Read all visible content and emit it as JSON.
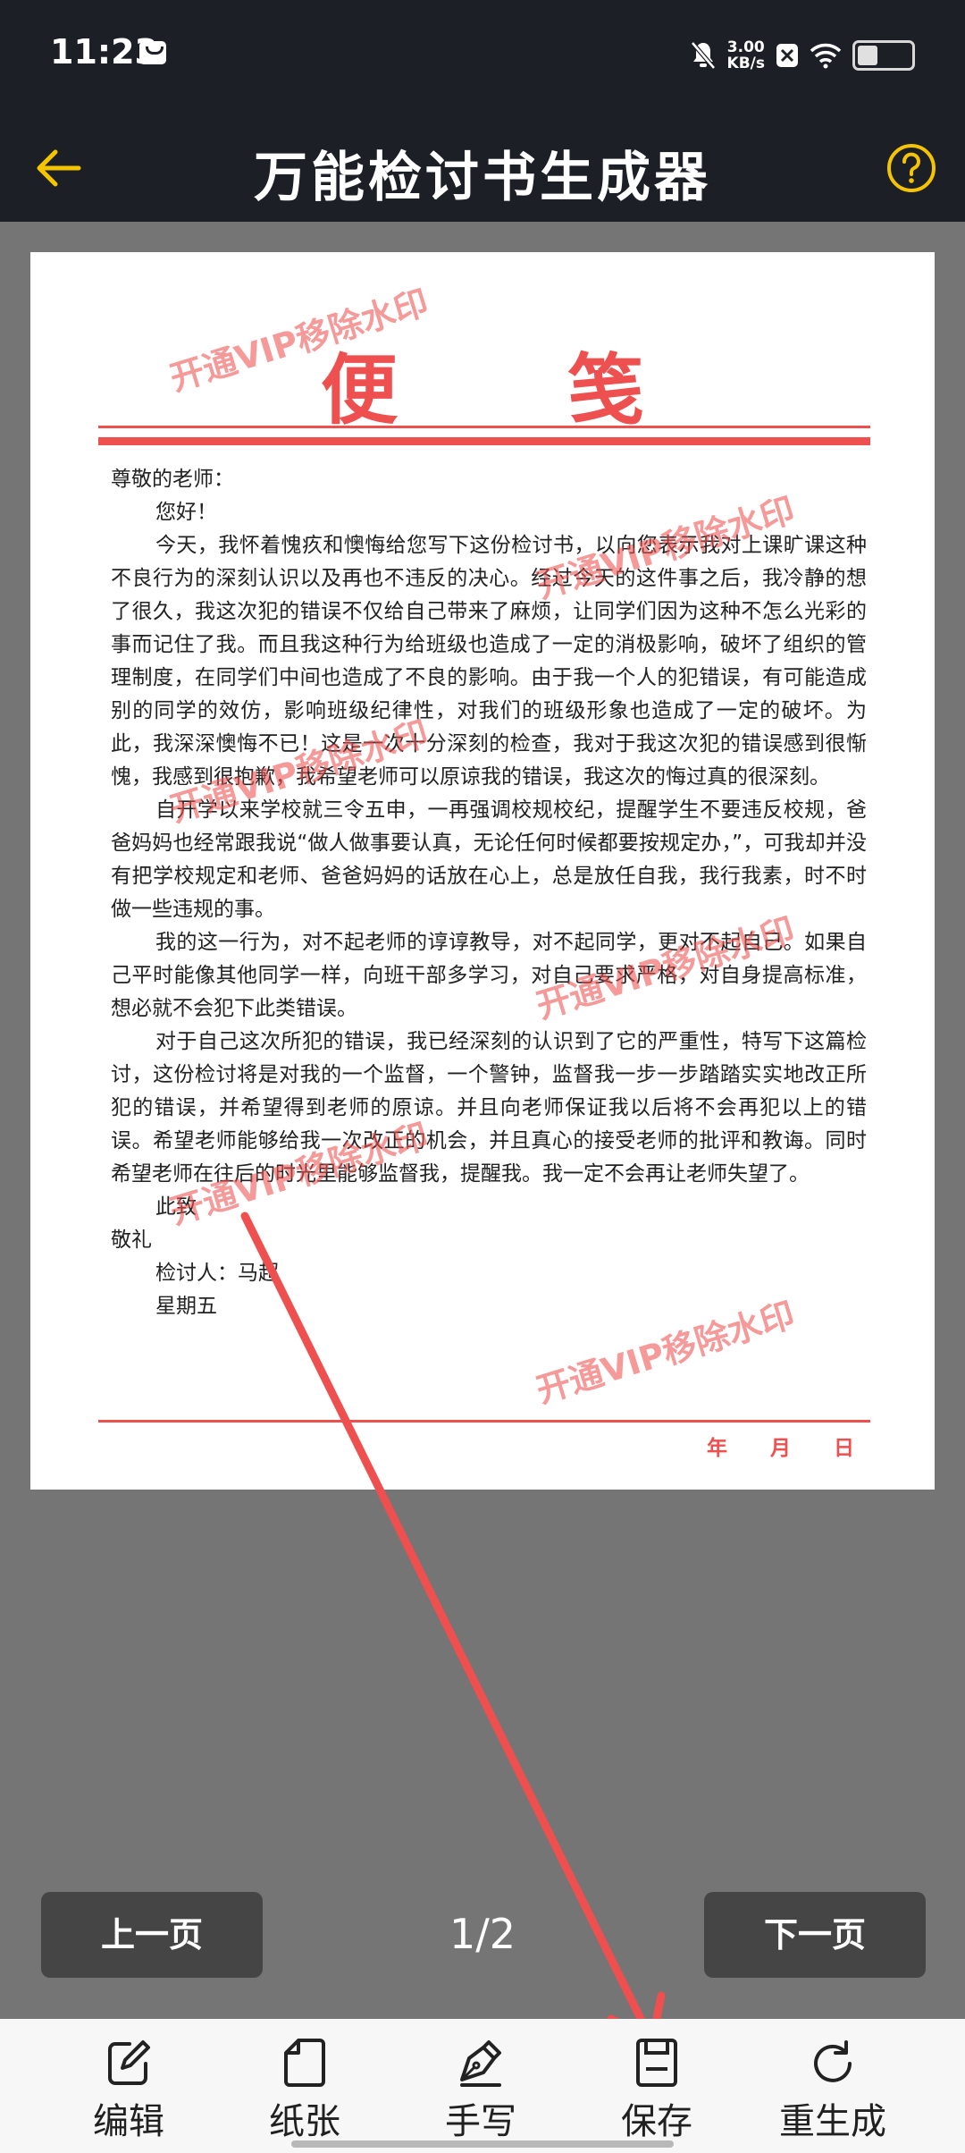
{
  "status": {
    "time": "11:23",
    "speed_value": "3.00",
    "speed_unit": "KB/s",
    "icons": [
      "message-icon",
      "mute-icon",
      "x-app-icon",
      "wifi-icon",
      "battery-icon"
    ],
    "battery_level": 0.3
  },
  "header": {
    "title": "万能检讨书生成器",
    "back_icon": "back-arrow-icon",
    "help_icon": "help-icon",
    "accent": "#f5c400"
  },
  "paper": {
    "heading": "便笺",
    "salutation": "尊敬的老师：",
    "greeting": "您好！",
    "paragraphs": [
      "今天，我怀着愧疚和懊悔给您写下这份检讨书，以向您表示我对上课旷课这种不良行为的深刻认识以及再也不违反的决心。经过今天的这件事之后，我冷静的想了很久，我这次犯的错误不仅给自己带来了麻烦，让同学们因为这种不怎么光彩的事而记住了我。而且我这种行为给班级也造成了一定的消极影响，破坏了组织的管理制度，在同学们中间也造成了不良的影响。由于我一个人的犯错误，有可能造成别的同学的效仿，影响班级纪律性，对我们的班级形象也造成了一定的破坏。为此，我深深懊悔不已！这是一次十分深刻的检查，我对于我这次犯的错误感到很惭愧，我感到很抱歉，我希望老师可以原谅我的错误，我这次的悔过真的很深刻。",
      "自开学以来学校就三令五申，一再强调校规校纪，提醒学生不要违反校规，爸爸妈妈也经常跟我说“做人做事要认真，无论任何时候都要按规定办，”，可我却并没有把学校规定和老师、爸爸妈妈的话放在心上，总是放任自我，我行我素，时不时做一些违规的事。",
      "我的这一行为，对不起老师的谆谆教导，对不起同学，更对不起自己。如果自己平时能像其他同学一样，向班干部多学习，对自己要求严格，对自身提高标准，想必就不会犯下此类错误。",
      "对于自己这次所犯的错误，我已经深刻的认识到了它的严重性，特写下这篇检讨，这份检讨将是对我的一个监督，一个警钟，监督我一步一步踏踏实实地改正所犯的错误，并希望得到老师的原谅。并且向老师保证我以后将不会再犯以上的错误。希望老师能够给我一次改正的机会，并且真心的接受老师的批评和教诲。同时希望老师在往后的时光里能够监督我，提醒我。我一定不会再让老师失望了。"
    ],
    "closing1": "此致",
    "closing2": "敬礼",
    "signer": "检讨人：马超",
    "weekday": "星期五",
    "date_labels": [
      "年",
      "月",
      "日"
    ],
    "watermark": "开通VIP移除水印",
    "accent": "#ee4f4f"
  },
  "pager": {
    "prev_label": "上一页",
    "next_label": "下一页",
    "indicator": "1/2"
  },
  "toolbar": {
    "items": [
      {
        "label": "编辑",
        "icon": "edit-icon"
      },
      {
        "label": "纸张",
        "icon": "paper-icon"
      },
      {
        "label": "手写",
        "icon": "pen-nib-icon"
      },
      {
        "label": "保存",
        "icon": "save-icon"
      },
      {
        "label": "重生成",
        "icon": "refresh-icon"
      }
    ]
  }
}
